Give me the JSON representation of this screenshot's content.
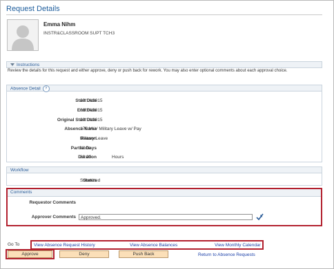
{
  "page": {
    "title": "Request Details"
  },
  "employee": {
    "name": "Emma Nihm",
    "job_title": "INSTR&CLASSROOM SUPT TCH3"
  },
  "instructions": {
    "header": "Instructions",
    "text": "Review the details for this request and either approve, deny or push back for rework. You may also enter optional comments about each approval choice."
  },
  "absence_detail": {
    "header": "Absence Detail",
    "help": "?",
    "fields": {
      "start_date": {
        "label": "Start Date",
        "value": "09/14/2015"
      },
      "end_date": {
        "label": "End Date",
        "value": "09/24/2015"
      },
      "original_start_date": {
        "label": "Original Start Date",
        "value": "09/14/2015"
      },
      "absence_name": {
        "label": "Absence Name",
        "value": "170 MLV Military Leave w/ Pay"
      },
      "reason": {
        "label": "Reason",
        "value": "Military Leave"
      },
      "partial_days": {
        "label": "Partial Days",
        "value": "None"
      },
      "duration": {
        "label": "Duration",
        "value": "80.00",
        "unit": "Hours"
      }
    }
  },
  "workflow": {
    "header": "Workflow",
    "status_label": "Status",
    "status_value": "Submitted"
  },
  "comments": {
    "header": "Comments",
    "requestor_label": "Requestor Comments",
    "approver_label": "Approver Comments",
    "approver_value": "Approved."
  },
  "goto": {
    "label": "Go To",
    "links": [
      "View Absence Request History",
      "View Absence Balances",
      "View Monthly Calendar"
    ]
  },
  "actions": {
    "approve": "Approve",
    "deny": "Deny",
    "push_back": "Push Back",
    "return_link": "Return to Absence Requests"
  },
  "colors": {
    "accent": "#2a5c98",
    "highlight": "#b21f2d",
    "button": "#fbdfb8"
  }
}
